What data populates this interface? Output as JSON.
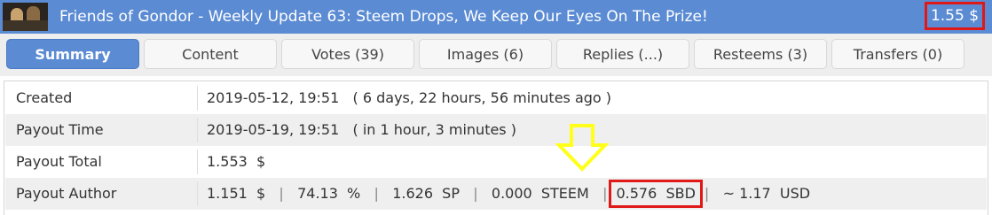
{
  "header": {
    "title": "Friends of Gondor - Weekly Update 63: Steem Drops, We Keep Our Eyes On The Prize!",
    "value": "1.55 $"
  },
  "tabs": [
    {
      "label": "Summary"
    },
    {
      "label": "Content"
    },
    {
      "label": "Votes (39)"
    },
    {
      "label": "Images (6)"
    },
    {
      "label": "Replies (...)"
    },
    {
      "label": "Resteems (3)"
    },
    {
      "label": "Transfers (0)"
    }
  ],
  "rows": {
    "created": {
      "label": "Created",
      "value": "2019-05-12, 19:51   ( 6 days, 22 hours, 56 minutes ago )"
    },
    "payout_time": {
      "label": "Payout Time",
      "value": "2019-05-19, 19:51   ( in 1 hour, 3 minutes )"
    },
    "payout_total": {
      "label": "Payout Total",
      "value": "1.553  $"
    },
    "payout_author": {
      "label": "Payout Author",
      "usd": "1.151  $",
      "percent": "74.13  %",
      "sp": "1.626  SP",
      "steem": "0.000  STEEM",
      "sbd": "0.576  SBD",
      "approx_usd": "~ 1.17  USD",
      "separator": "|"
    }
  },
  "colors": {
    "accent": "#5b8bd3",
    "highlight_box": "#e01818",
    "arrow": "#ffff1a"
  },
  "icons": {
    "thumbnail": "post-thumbnail",
    "arrow": "down-arrow-icon"
  }
}
